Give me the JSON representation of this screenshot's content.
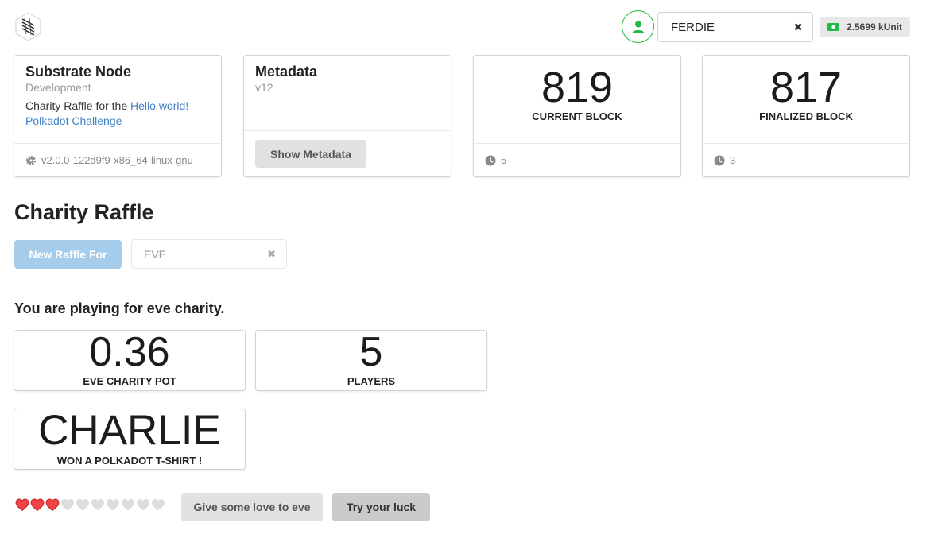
{
  "header": {
    "logo": "substrate-logo",
    "account": {
      "name": "FERDIE",
      "clear_icon": "close-icon",
      "avatar_icon": "user-icon"
    },
    "balance": {
      "value": "2.5699 kUnit",
      "icon": "money-icon",
      "color": "#21ba45"
    }
  },
  "node_info": {
    "title": "Substrate Node",
    "subtitle": "Development",
    "description_prefix": "Charity Raffle for the ",
    "description_link": "Hello world! Polkadot Challenge",
    "version": "v2.0.0-122d9f9-x86_64-linux-gnu"
  },
  "metadata": {
    "title": "Metadata",
    "version": "v12",
    "button_label": "Show Metadata"
  },
  "current_block": {
    "value": "819",
    "label": "CURRENT BLOCK",
    "timer": "5"
  },
  "finalized_block": {
    "value": "817",
    "label": "FINALIZED BLOCK",
    "timer": "3"
  },
  "raffle": {
    "heading": "Charity Raffle",
    "new_raffle_label": "New Raffle For",
    "selected_charity": "EVE",
    "playing_text": "You are playing for eve charity.",
    "pot": {
      "value": "0.36",
      "label": "EVE CHARITY POT"
    },
    "players": {
      "value": "5",
      "label": "PLAYERS"
    },
    "winner": {
      "value": "CHARLIE",
      "label": "WON A POLKADOT T-SHIRT !"
    },
    "love": {
      "filled": 3,
      "total": 10,
      "filled_color": "#ef4444",
      "empty_color": "#dddddd"
    },
    "love_button": "Give some love to eve",
    "luck_button": "Try your luck"
  },
  "colors": {
    "accent": "#4183c4",
    "primary_disabled": "#a5cdeb",
    "green": "#21ba45"
  }
}
